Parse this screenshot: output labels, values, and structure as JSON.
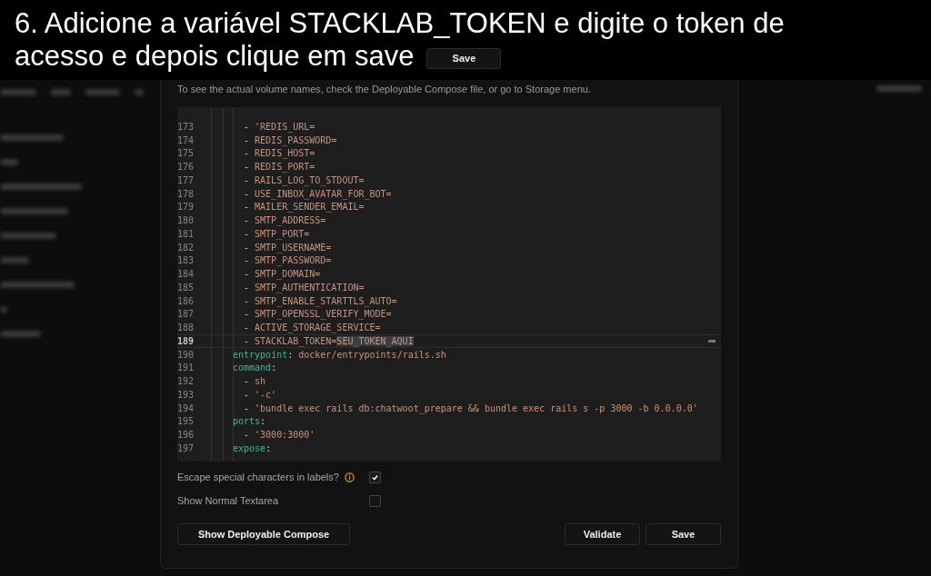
{
  "caption": {
    "lines": [
      "6. Adicione a variável STACKLAB_TOKEN e digite o token de",
      "acesso e depois clique em save"
    ],
    "button": "Save"
  },
  "dialog": {
    "note": "To see the actual volume names, check the Deployable Compose file, or go to Storage menu.",
    "editor": {
      "lines": [
        {
          "number": "173",
          "kind": "item",
          "current": false,
          "segments": [
            {
              "text": "- ",
              "kind": "plain"
            },
            {
              "text": "'REDIS_URL=",
              "kind": "string"
            }
          ]
        },
        {
          "number": "174",
          "kind": "item",
          "current": false,
          "segments": [
            {
              "text": "- ",
              "kind": "plain"
            },
            {
              "text": "REDIS_PASSWORD=",
              "kind": "string"
            }
          ]
        },
        {
          "number": "175",
          "kind": "item",
          "current": false,
          "segments": [
            {
              "text": "- ",
              "kind": "plain"
            },
            {
              "text": "REDIS_HOST=",
              "kind": "string"
            }
          ]
        },
        {
          "number": "176",
          "kind": "item",
          "current": false,
          "segments": [
            {
              "text": "- ",
              "kind": "plain"
            },
            {
              "text": "REDIS_PORT=",
              "kind": "string"
            }
          ]
        },
        {
          "number": "177",
          "kind": "item",
          "current": false,
          "segments": [
            {
              "text": "- ",
              "kind": "plain"
            },
            {
              "text": "RAILS_LOG_TO_STDOUT=",
              "kind": "string"
            }
          ]
        },
        {
          "number": "178",
          "kind": "item",
          "current": false,
          "segments": [
            {
              "text": "- ",
              "kind": "plain"
            },
            {
              "text": "USE_INBOX_AVATAR_FOR_BOT=",
              "kind": "string"
            }
          ]
        },
        {
          "number": "179",
          "kind": "item",
          "current": false,
          "segments": [
            {
              "text": "- ",
              "kind": "plain"
            },
            {
              "text": "MAILER_SENDER_EMAIL=",
              "kind": "string"
            }
          ]
        },
        {
          "number": "180",
          "kind": "item",
          "current": false,
          "segments": [
            {
              "text": "- ",
              "kind": "plain"
            },
            {
              "text": "SMTP_ADDRESS=",
              "kind": "string"
            }
          ]
        },
        {
          "number": "181",
          "kind": "item",
          "current": false,
          "segments": [
            {
              "text": "- ",
              "kind": "plain"
            },
            {
              "text": "SMTP_PORT=",
              "kind": "string"
            }
          ]
        },
        {
          "number": "182",
          "kind": "item",
          "current": false,
          "segments": [
            {
              "text": "- ",
              "kind": "plain"
            },
            {
              "text": "SMTP_USERNAME=",
              "kind": "string"
            }
          ]
        },
        {
          "number": "183",
          "kind": "item",
          "current": false,
          "segments": [
            {
              "text": "- ",
              "kind": "plain"
            },
            {
              "text": "SMTP_PASSWORD=",
              "kind": "string"
            }
          ]
        },
        {
          "number": "184",
          "kind": "item",
          "current": false,
          "segments": [
            {
              "text": "- ",
              "kind": "plain"
            },
            {
              "text": "SMTP_DOMAIN=",
              "kind": "string"
            }
          ]
        },
        {
          "number": "185",
          "kind": "item",
          "current": false,
          "segments": [
            {
              "text": "- ",
              "kind": "plain"
            },
            {
              "text": "SMTP_AUTHENTICATION=",
              "kind": "string"
            }
          ]
        },
        {
          "number": "186",
          "kind": "item",
          "current": false,
          "segments": [
            {
              "text": "- ",
              "kind": "plain"
            },
            {
              "text": "SMTP_ENABLE_STARTTLS_AUTO=",
              "kind": "string"
            }
          ]
        },
        {
          "number": "187",
          "kind": "item",
          "current": false,
          "segments": [
            {
              "text": "- ",
              "kind": "plain"
            },
            {
              "text": "SMTP_OPENSSL_VERIFY_MODE=",
              "kind": "string"
            }
          ]
        },
        {
          "number": "188",
          "kind": "item",
          "current": false,
          "segments": [
            {
              "text": "- ",
              "kind": "plain"
            },
            {
              "text": "ACTIVE_STORAGE_SERVICE=",
              "kind": "string"
            }
          ]
        },
        {
          "number": "189",
          "kind": "item",
          "current": true,
          "segments": [
            {
              "text": "- ",
              "kind": "plain"
            },
            {
              "text": "STACKLAB_TOKEN=",
              "kind": "string"
            },
            {
              "text": "SEU_TOKEN_AQUI",
              "kind": "selection"
            }
          ]
        },
        {
          "number": "190",
          "kind": "key",
          "current": false,
          "segments": [
            {
              "text": "entrypoint",
              "kind": "key"
            },
            {
              "text": ": ",
              "kind": "plain"
            },
            {
              "text": "docker/entrypoints/rails.sh",
              "kind": "string"
            }
          ]
        },
        {
          "number": "191",
          "kind": "key",
          "current": false,
          "segments": [
            {
              "text": "command",
              "kind": "key"
            },
            {
              "text": ":",
              "kind": "plain"
            }
          ]
        },
        {
          "number": "192",
          "kind": "item",
          "current": false,
          "segments": [
            {
              "text": "- ",
              "kind": "plain"
            },
            {
              "text": "sh",
              "kind": "string"
            }
          ]
        },
        {
          "number": "193",
          "kind": "item",
          "current": false,
          "segments": [
            {
              "text": "- ",
              "kind": "plain"
            },
            {
              "text": "'-c'",
              "kind": "string"
            }
          ]
        },
        {
          "number": "194",
          "kind": "item",
          "current": false,
          "segments": [
            {
              "text": "- ",
              "kind": "plain"
            },
            {
              "text": "'bundle exec rails db:chatwoot_prepare && bundle exec rails s -p 3000 -b 0.0.0.0'",
              "kind": "string"
            }
          ]
        },
        {
          "number": "195",
          "kind": "key",
          "current": false,
          "segments": [
            {
              "text": "ports",
              "kind": "key"
            },
            {
              "text": ":",
              "kind": "plain"
            }
          ]
        },
        {
          "number": "196",
          "kind": "item",
          "current": false,
          "segments": [
            {
              "text": "- ",
              "kind": "plain"
            },
            {
              "text": "'3000:3000'",
              "kind": "string"
            }
          ]
        },
        {
          "number": "197",
          "kind": "key",
          "current": false,
          "segments": [
            {
              "text": "expose",
              "kind": "key"
            },
            {
              "text": ":",
              "kind": "plain"
            }
          ]
        }
      ]
    },
    "options": [
      {
        "label": "Escape special characters in labels?",
        "info": true,
        "checked": true
      },
      {
        "label": "Show Normal Textarea",
        "info": false,
        "checked": false
      }
    ],
    "buttons": [
      {
        "label": "Show Deployable Compose",
        "kind": "aside"
      },
      {
        "label": "Validate",
        "kind": "action"
      },
      {
        "label": "Save",
        "kind": "action"
      }
    ]
  }
}
